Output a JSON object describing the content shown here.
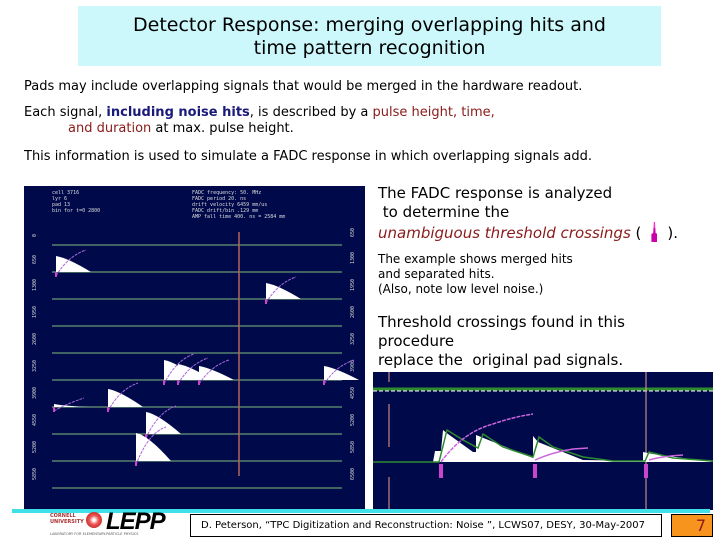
{
  "slide": {
    "title_line1": "Detector Response: merging overlapping hits and",
    "title_line2": "time pattern recognition",
    "paragraphs": {
      "p1": "Pads may include overlapping signals that would be merged in the hardware readout.",
      "p2_a": "Each signal, ",
      "p2_bold": "including noise hits",
      "p2_b": ", is described by a ",
      "p2_red1": "pulse height, time,",
      "p2_red2": "and duration",
      "p2_c": " at max. pulse height.",
      "p3": "This information is used to simulate a FADC response in which overlapping signals add."
    },
    "right_text": {
      "r1_line1": "The FADC response is analyzed",
      "r1_line2": " to determine the",
      "r1_italic": "unambiguous threshold crossings",
      "r1_open": " (",
      "r1_close": ").",
      "r2_line1": "The example shows merged hits",
      "r2_line2": "and separated hits.",
      "r2_line3": "(Also, note low level noise.)",
      "r3_line1": "Threshold crossings found in this",
      "r3_line2": "procedure",
      "r3_line3": "replace the  original pad signals."
    },
    "plot_header_left": [
      "cell   3716",
      "lyr      6",
      "pad     13",
      "bin for t=0    2800"
    ],
    "plot_header_right": [
      "FADC frequency:   50. MHz",
      "FADC period      20. ns",
      "drift velocity  6459 mm/us",
      "FADC drift/bin  .129 mm",
      "AMP fall time    400. ns =  2584 mm"
    ],
    "plot_row_labels_left": [
      "0",
      "650",
      "1300",
      "1950",
      "2600",
      "3250",
      "3900",
      "4550",
      "5200",
      "5850"
    ],
    "plot_row_labels_right": [
      "650",
      "1300",
      "1950",
      "2600",
      "3250",
      "3900",
      "4550",
      "5200",
      "5850",
      "6500"
    ],
    "footer": {
      "logo_text": "LEPP",
      "logo_sub1": "CORNELL",
      "logo_sub2": "UNIVERSITY",
      "logo_caption": "LABORATORY FOR ELEMENTARY-PARTICLE PHYSICS",
      "citation": "D. Peterson, “TPC Digitization and Reconstruction: Noise ”, LCWS07,  DESY, 30-May-2007",
      "page_number": "7"
    },
    "colors": {
      "title_bg": "#ccf8fb",
      "plot_bg": "#000a4a",
      "accent_cyan": "#40e0e8",
      "page_badge": "#f7941d",
      "emphasis_red": "#8b1a1a",
      "emphasis_blue": "#1a1a7a",
      "crossing_marker": "#cc00aa"
    }
  }
}
